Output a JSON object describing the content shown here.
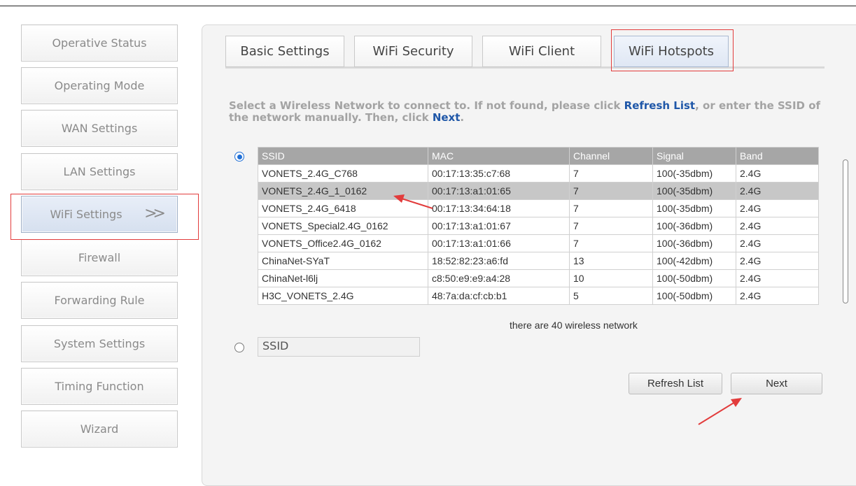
{
  "sidebar": {
    "items": [
      {
        "label": "Operative Status"
      },
      {
        "label": "Operating Mode"
      },
      {
        "label": "WAN Settings"
      },
      {
        "label": "LAN Settings"
      },
      {
        "label": "WiFi Settings",
        "active": true,
        "chevron": ">>"
      },
      {
        "label": "Firewall"
      },
      {
        "label": "Forwarding Rule"
      },
      {
        "label": "System Settings"
      },
      {
        "label": "Timing Function"
      },
      {
        "label": "Wizard"
      }
    ]
  },
  "tabs": [
    {
      "label": "Basic Settings"
    },
    {
      "label": "WiFi Security"
    },
    {
      "label": "WiFi Client"
    },
    {
      "label": "WiFi Hotspots",
      "active": true
    }
  ],
  "instructions": {
    "part1": "Select a Wireless Network to connect to. If not found, please click ",
    "link1": "Refresh List",
    "part2": ", or enter the SSID of the network manually. Then, click ",
    "link2": "Next",
    "part3": "."
  },
  "table": {
    "headers": [
      "SSID",
      "MAC",
      "Channel",
      "Signal",
      "Band"
    ],
    "rows": [
      [
        "VONETS_2.4G_C768",
        "00:17:13:35:c7:68",
        "7",
        "100(-35dbm)",
        "2.4G"
      ],
      [
        "VONETS_2.4G_1_0162",
        "00:17:13:a1:01:65",
        "7",
        "100(-35dbm)",
        "2.4G"
      ],
      [
        "VONETS_2.4G_6418",
        "00:17:13:34:64:18",
        "7",
        "100(-35dbm)",
        "2.4G"
      ],
      [
        "VONETS_Special2.4G_0162",
        "00:17:13:a1:01:67",
        "7",
        "100(-36dbm)",
        "2.4G"
      ],
      [
        "VONETS_Office2.4G_0162",
        "00:17:13:a1:01:66",
        "7",
        "100(-36dbm)",
        "2.4G"
      ],
      [
        "ChinaNet-SYaT",
        "18:52:82:23:a6:fd",
        "13",
        "100(-42dbm)",
        "2.4G"
      ],
      [
        "ChinaNet-l6lj",
        "c8:50:e9:e9:a4:28",
        "10",
        "100(-50dbm)",
        "2.4G"
      ],
      [
        "H3C_VONETS_2.4G",
        "48:7a:da:cf:cb:b1",
        "5",
        "100(-50dbm)",
        "2.4G"
      ]
    ],
    "selected_row": 1
  },
  "network_count": "there are 40 wireless network",
  "ssid_input": {
    "value": "SSID"
  },
  "buttons": {
    "refresh": "Refresh List",
    "next": "Next"
  },
  "colors": {
    "highlight_box": "#e23c3c",
    "link": "#1f57a8",
    "radio_checked": "#1f6fd6"
  }
}
